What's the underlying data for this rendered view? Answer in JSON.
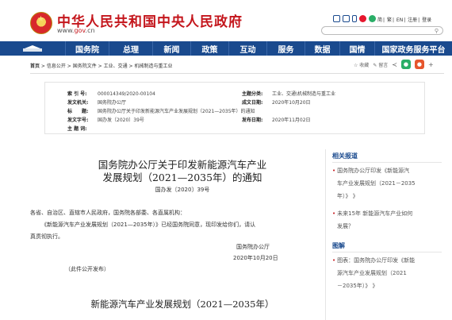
{
  "header": {
    "title": "中华人民共和国中央人民政府",
    "url_prefix": "www.",
    "url_brand": "gov",
    "url_suffix": ".cn",
    "links": [
      "简",
      "繁",
      "EN",
      "注册",
      "登录"
    ]
  },
  "nav": {
    "items": [
      "国务院",
      "总理",
      "新闻",
      "政策",
      "互动",
      "服务",
      "数据",
      "国情",
      "国家政务服务平台"
    ],
    "bg_color": "#1a4a8e"
  },
  "breadcrumb": {
    "home": "首页",
    "items": [
      "信息公开",
      "国务院文件",
      "工业、交通",
      "机械制造与重工业"
    ],
    "sep": " > ",
    "favorite": "收藏",
    "comment": "留言"
  },
  "meta": {
    "index_no_label": "索 引 号:",
    "index_no": "000014349/2020-00104",
    "category_label": "主题分类:",
    "category": "工业、交通\\机械制造与重工业",
    "issuer_label": "发文机关:",
    "issuer": "国务院办公厅",
    "date_label": "成文日期:",
    "date": "2020年10月20日",
    "subject_label": "标　　题:",
    "subject": "国务院办公厅关于印发新能源汽车产业发展规划（2021—2035年）的通知",
    "docno_label": "发文字号:",
    "docno": "国办发〔2020〕39号",
    "pubdate_label": "发布日期:",
    "pubdate": "2020年11月02日",
    "keywords_label": "主 题 词:",
    "keywords": ""
  },
  "article": {
    "title_line1": "国务院办公厅关于印发新能源汽车产业",
    "title_line2": "发展规划（2021—2035年）的通知",
    "doc_number": "国办发〔2020〕39号",
    "addressee": "各省、自治区、直辖市人民政府，国务院各部委、各直属机构：",
    "body_line1": "《新能源汽车产业发展规划（2021—2035年）》已经国务院同意，现印发给你们，请认",
    "body_line2": "真贯彻执行。",
    "signer": "国务院办公厅",
    "sign_date": "2020年10月20日",
    "public_note": "（此件公开发布）",
    "section_title": "新能源汽车产业发展规划（2021—2035年）"
  },
  "sidebar": {
    "related_heading": "相关报道",
    "related": [
      {
        "lines": [
          "国务院办公厅印发《新能源汽",
          "车产业发展规划（2021－2035",
          "年）》 》"
        ]
      },
      {
        "lines": [
          "未来15年 新能源汽车产业如何",
          "发展？"
        ]
      }
    ],
    "graphic_heading": "图解",
    "graphic": [
      {
        "lines": [
          "图表：国务院办公厅印发《新能",
          "源汽车产业发展规划（2021",
          "－2035年）》 》"
        ]
      }
    ]
  },
  "colors": {
    "brand_red": "#c4161c",
    "nav_blue": "#1a4a8e",
    "link_blue": "#1a4a8e"
  }
}
